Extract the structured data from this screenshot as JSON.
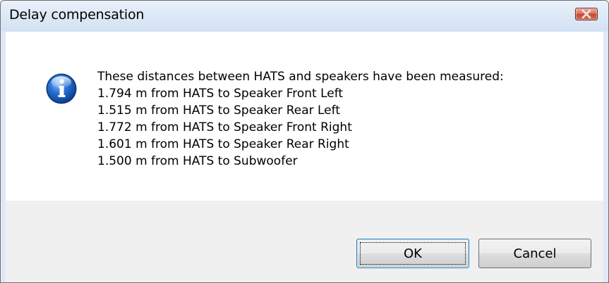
{
  "window": {
    "title": "Delay compensation"
  },
  "icons": {
    "close": "close-icon",
    "info": "information-icon"
  },
  "message": {
    "heading": "These distances between HATS and speakers have been measured:",
    "lines": [
      "1.794 m from HATS to Speaker Front Left",
      "1.515 m from HATS to Speaker Rear Left",
      "1.772 m from HATS to Speaker Front Right",
      "1.601 m from HATS to Speaker Rear Right",
      "1.500 m from HATS to Subwoofer"
    ]
  },
  "buttons": {
    "ok_label": "OK",
    "cancel_label": "Cancel"
  },
  "colors": {
    "close_button": "#c9553d",
    "info_icon": "#1f63c4",
    "footer_background": "#f0f0f0"
  }
}
